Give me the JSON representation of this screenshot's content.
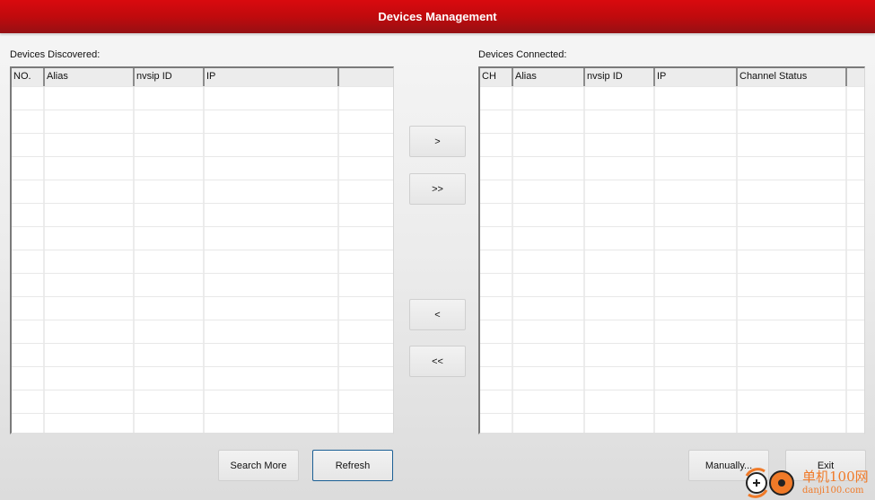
{
  "window": {
    "title": "Devices Management"
  },
  "discovered": {
    "label": "Devices Discovered:",
    "columns": [
      "NO.",
      "Alias",
      "nvsip ID",
      "IP",
      ""
    ],
    "rows": []
  },
  "connected": {
    "label": "Devices Connected:",
    "columns": [
      "CH",
      "Alias",
      "nvsip ID",
      "IP",
      "Channel Status",
      ""
    ],
    "rows": []
  },
  "transfer": {
    "add_one": ">",
    "add_all": ">>",
    "remove_one": "<",
    "remove_all": "<<"
  },
  "footer": {
    "search_more": "Search More",
    "refresh": "Refresh",
    "manually": "Manually...",
    "exit": "Exit"
  },
  "watermark": {
    "cn": "单机100网",
    "en": "danji100.com",
    "accent": "#f07a28"
  },
  "colors": {
    "titlebar": "#c00a0d",
    "focus_border": "#1b5f95"
  }
}
